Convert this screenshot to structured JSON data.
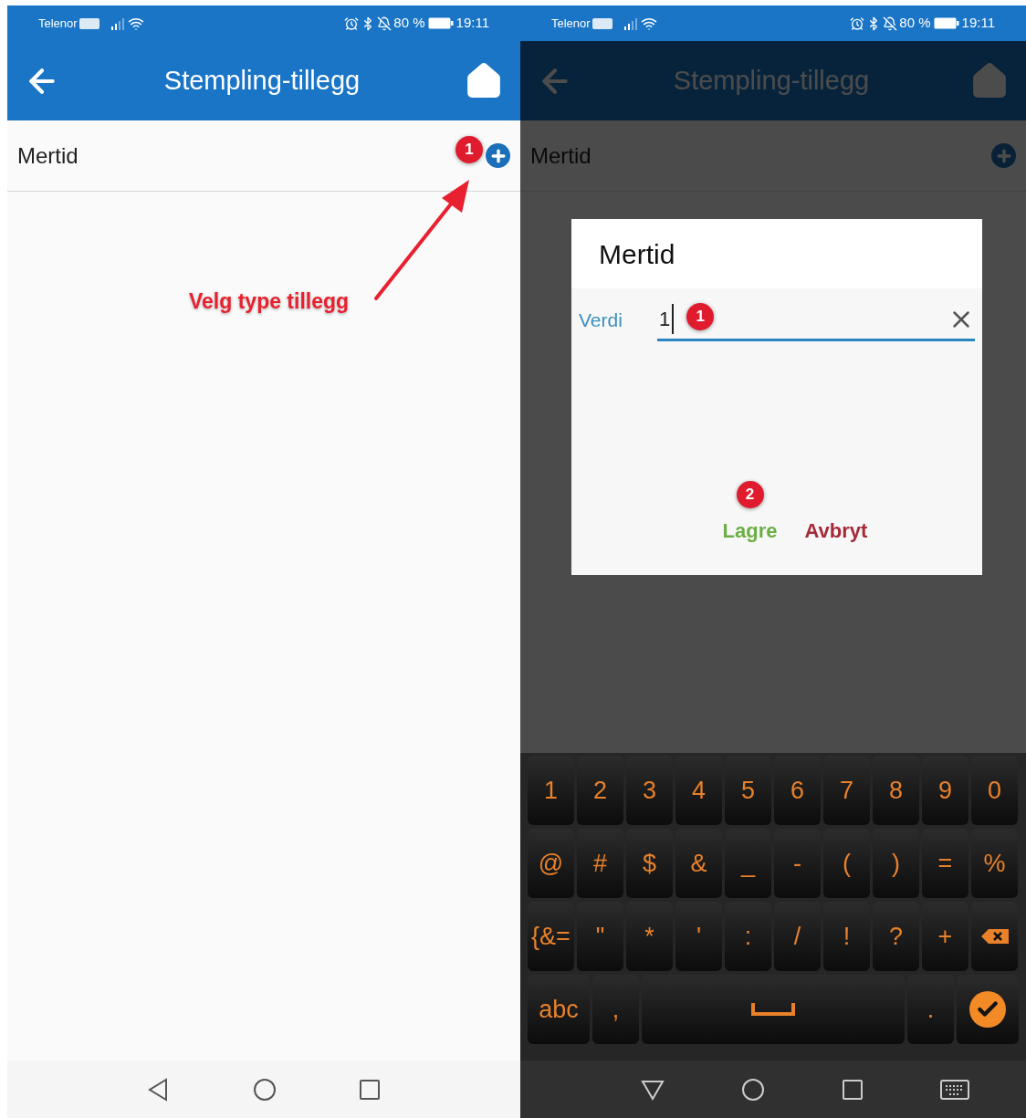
{
  "screens": [
    {
      "dimmed": false,
      "status_bar": {
        "carrier": "Telenor",
        "battery": "80 %",
        "time": "19:11"
      },
      "app_bar": {
        "title": "Stempling-tillegg"
      },
      "list": [
        {
          "label": "Mertid"
        }
      ],
      "annotation": {
        "badge": "1",
        "callout": "Velg type tillegg"
      }
    },
    {
      "dimmed": true,
      "status_bar": {
        "carrier": "Telenor",
        "battery": "80 %",
        "time": "19:11"
      },
      "app_bar": {
        "title": "Stempling-tillegg"
      },
      "list": [
        {
          "label": "Mertid"
        }
      ],
      "dialog": {
        "title": "Mertid",
        "field_label": "Verdi",
        "value": "1",
        "field_badge": "1",
        "button_badge": "2",
        "buttons": [
          {
            "label": "Lagre",
            "kind": "save"
          },
          {
            "label": "Avbryt",
            "kind": "cancel"
          }
        ]
      },
      "keyboard": {
        "rows": [
          [
            {
              "kind": "char",
              "label": "1"
            },
            {
              "kind": "char",
              "label": "2"
            },
            {
              "kind": "char",
              "label": "3"
            },
            {
              "kind": "char",
              "label": "4"
            },
            {
              "kind": "char",
              "label": "5"
            },
            {
              "kind": "char",
              "label": "6"
            },
            {
              "kind": "char",
              "label": "7"
            },
            {
              "kind": "char",
              "label": "8"
            },
            {
              "kind": "char",
              "label": "9"
            },
            {
              "kind": "char",
              "label": "0"
            }
          ],
          [
            {
              "kind": "char",
              "label": "@"
            },
            {
              "kind": "char",
              "label": "#"
            },
            {
              "kind": "char",
              "label": "$"
            },
            {
              "kind": "char",
              "label": "&"
            },
            {
              "kind": "char",
              "label": "_"
            },
            {
              "kind": "char",
              "label": "-"
            },
            {
              "kind": "char",
              "label": "("
            },
            {
              "kind": "char",
              "label": ")"
            },
            {
              "kind": "char",
              "label": "="
            },
            {
              "kind": "char",
              "label": "%"
            }
          ],
          [
            {
              "kind": "char",
              "label": "{&="
            },
            {
              "kind": "char",
              "label": "\""
            },
            {
              "kind": "char",
              "label": "*"
            },
            {
              "kind": "char",
              "label": "'"
            },
            {
              "kind": "char",
              "label": ":"
            },
            {
              "kind": "char",
              "label": "/"
            },
            {
              "kind": "char",
              "label": "!"
            },
            {
              "kind": "char",
              "label": "?"
            },
            {
              "kind": "char",
              "label": "+"
            },
            {
              "kind": "backspace"
            }
          ],
          [
            {
              "kind": "wide",
              "label": "abc"
            },
            {
              "kind": "char",
              "label": ","
            },
            {
              "kind": "space"
            },
            {
              "kind": "char",
              "label": "."
            },
            {
              "kind": "enter"
            }
          ]
        ]
      }
    }
  ]
}
